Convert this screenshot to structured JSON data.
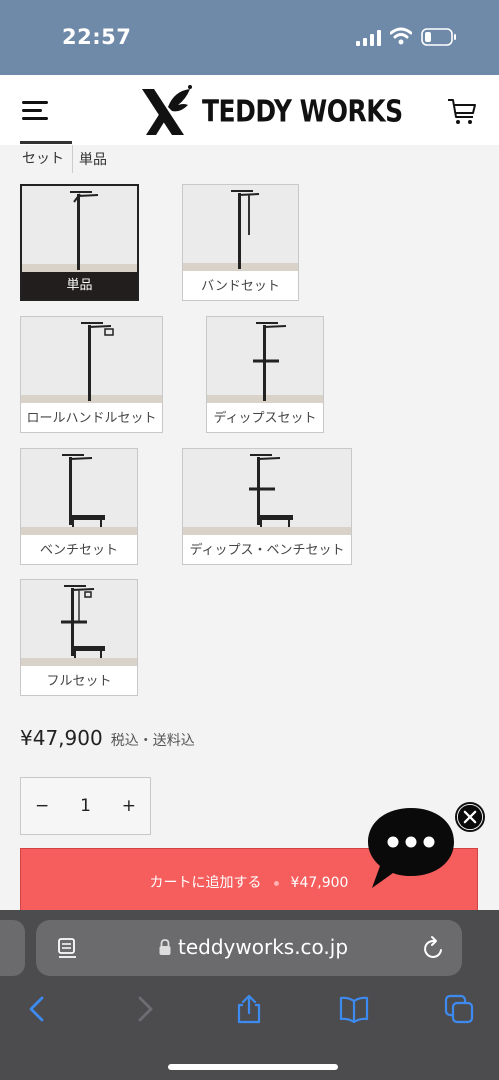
{
  "status_bar": {
    "time": "22:57"
  },
  "header": {
    "brand": "TEDDY WORKS",
    "logo_letter": "X"
  },
  "tabs": [
    {
      "label": "セット"
    },
    {
      "label": "単品"
    }
  ],
  "variants": [
    {
      "label": "単品",
      "selected": true
    },
    {
      "label": "バンドセット",
      "selected": false
    },
    {
      "label": "ロールハンドルセット",
      "selected": false
    },
    {
      "label": "ディップスセット",
      "selected": false
    },
    {
      "label": "ベンチセット",
      "selected": false
    },
    {
      "label": "ディップス・ベンチセット",
      "selected": false
    },
    {
      "label": "フルセット",
      "selected": false
    }
  ],
  "price": {
    "amount": "¥47,900",
    "note": "税込・送料込"
  },
  "quantity": {
    "minus": "−",
    "value": "1",
    "plus": "+"
  },
  "add_to_cart": {
    "label": "カートに追加する",
    "price": "¥47,900"
  },
  "browser": {
    "url": "teddyworks.co.jp"
  },
  "colors": {
    "status_bar": "#6f89a8",
    "button": "#f65d5d",
    "safari_bar": "#4c4c4e",
    "accent_blue": "#3d8bf0"
  }
}
